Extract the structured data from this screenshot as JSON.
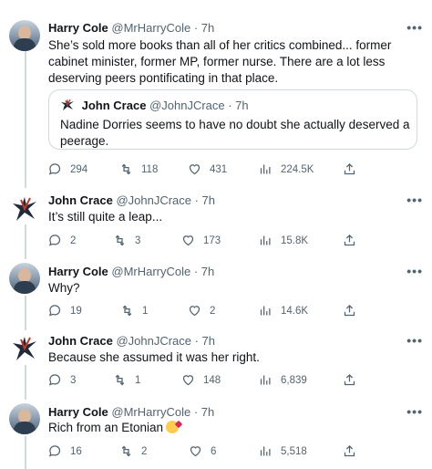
{
  "tweets": [
    {
      "name": "Harry Cole",
      "handle": "@MrHarryCole · 7h",
      "text": "She’s sold more books than all of her critics combined... former cabinet minister, former MP, former nurse. There are a lot less deserving peers pontificating in that place.",
      "quote": {
        "name": "John Crace",
        "handle": "@JohnJCrace · 7h",
        "text": "Nadine Dorries seems to have no doubt she actually deserved a peerage."
      },
      "replies": "294",
      "retweets": "118",
      "likes": "431",
      "views": "224.5K"
    },
    {
      "name": "John Crace",
      "handle": "@JohnJCrace · 7h",
      "text": "It’s still quite a leap...",
      "replies": "2",
      "retweets": "3",
      "likes": "173",
      "views": "15.8K"
    },
    {
      "name": "Harry Cole",
      "handle": "@MrHarryCole · 7h",
      "text": "Why?",
      "replies": "19",
      "retweets": "1",
      "likes": "2",
      "views": "14.6K"
    },
    {
      "name": "John Crace",
      "handle": "@JohnJCrace · 7h",
      "text": "Because she assumed it was her right.",
      "replies": "3",
      "retweets": "1",
      "likes": "148",
      "views": "6,839"
    },
    {
      "name": "Harry Cole",
      "handle": "@MrHarryCole · 7h",
      "text": "Rich from an Etonian",
      "replies": "16",
      "retweets": "2",
      "likes": "6",
      "views": "5,518"
    }
  ],
  "more_label": "•••"
}
